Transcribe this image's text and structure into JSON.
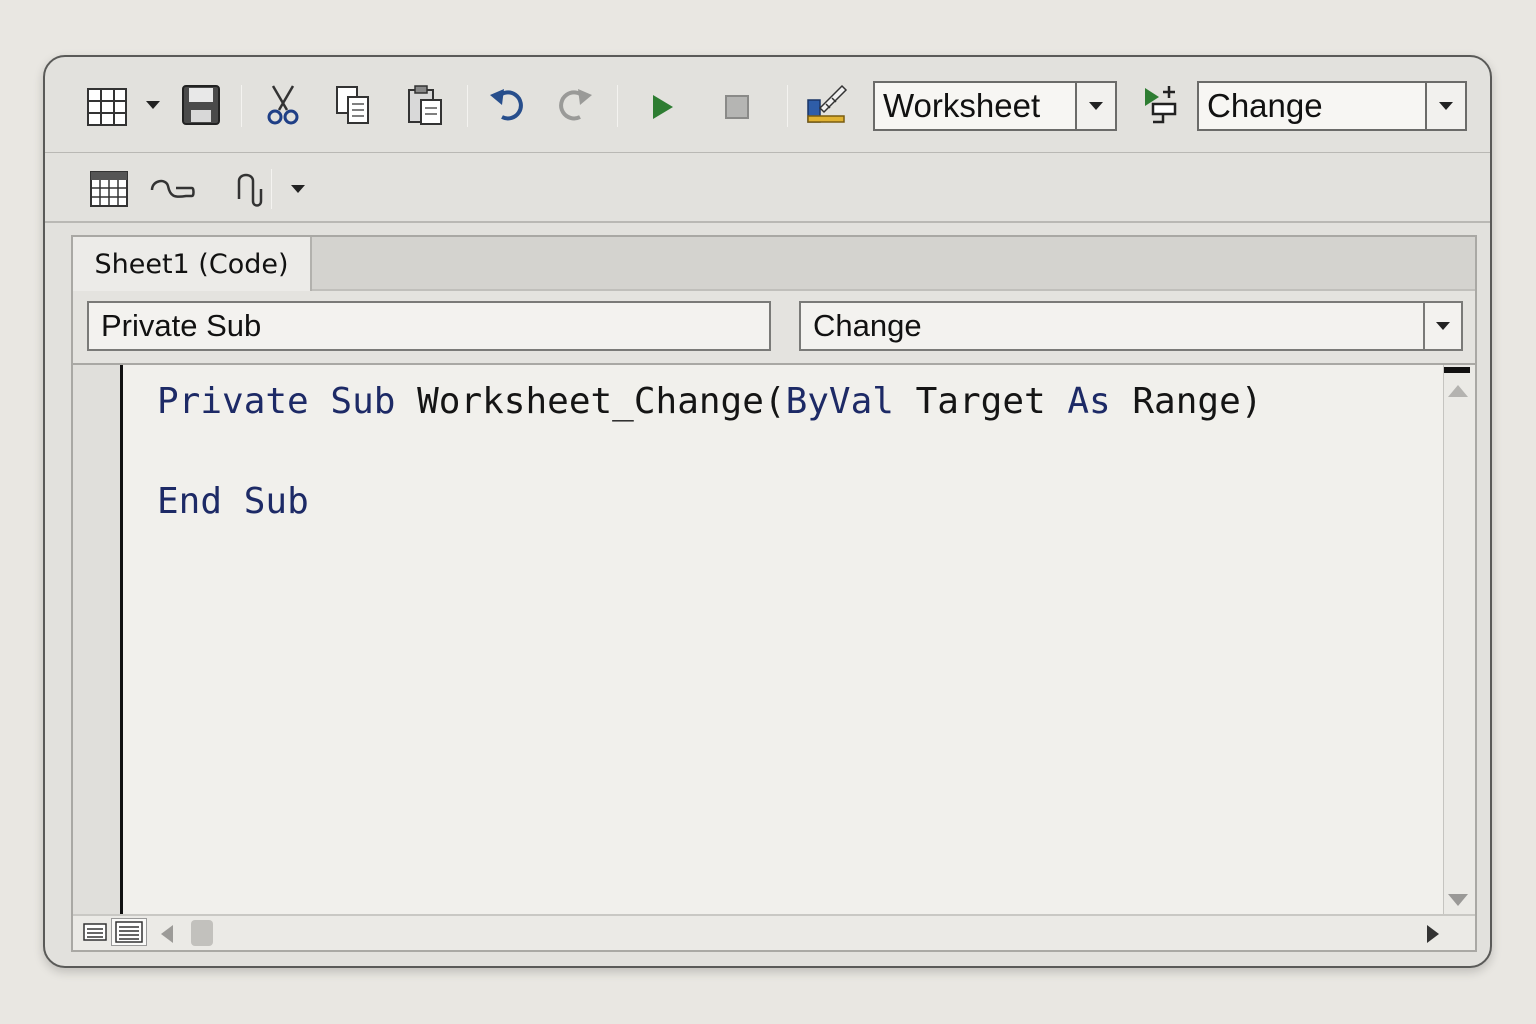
{
  "toolbar": {
    "object_combo": "Worksheet",
    "procedure_combo": "Change"
  },
  "code_window": {
    "tab_label": "Sheet1 (Code)",
    "object_box": "Private Sub",
    "procedure_box": "Change",
    "lines": [
      {
        "keyword1": "Private",
        "keyword2": "Sub",
        "text": " Worksheet_Change(",
        "kw3": "ByVal",
        "text2": " Target ",
        "kw4": "As",
        "text3": " Range)"
      },
      {
        "text": ""
      },
      {
        "keyword1": "End",
        "keyword2": "Sub"
      }
    ]
  },
  "colors": {
    "keyword": "#1d2a66",
    "run_green": "#2e7d32",
    "undo_blue": "#274e8c"
  },
  "icons": {
    "view-excel": "grid-icon",
    "save": "floppy-icon",
    "cut": "scissors-icon",
    "copy": "copy-icon",
    "paste": "clipboard-icon",
    "undo": "undo-icon",
    "redo": "redo-icon",
    "run": "play-icon",
    "reset": "stop-icon",
    "design-mode": "design-mode-icon",
    "insert-proc": "insert-procedure-icon"
  }
}
